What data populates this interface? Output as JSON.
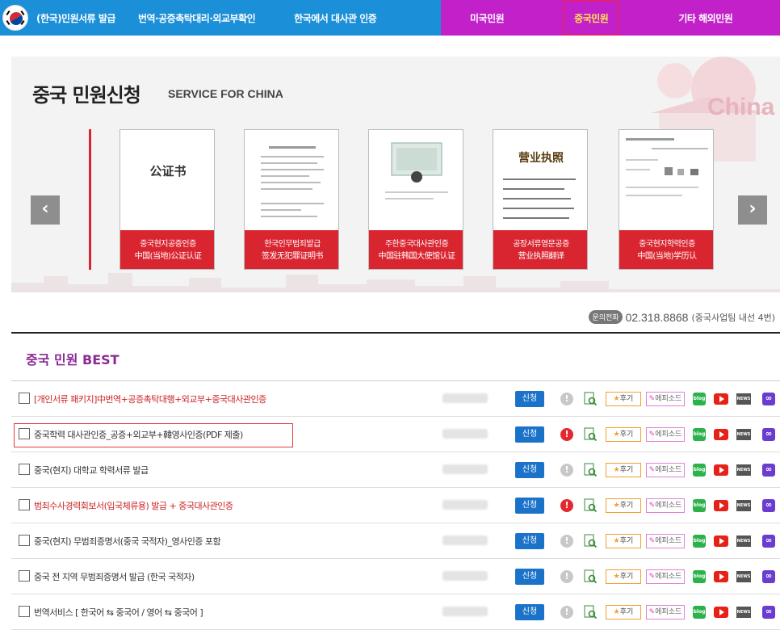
{
  "nav": {
    "items": [
      {
        "label": "(한국)민원서류 발급"
      },
      {
        "label": "번역·공증촉탁대리·외교부확인"
      },
      {
        "label": "한국에서 대사관 인증"
      },
      {
        "label": "미국민원"
      },
      {
        "label": "중국민원"
      },
      {
        "label": "기타 해외민원"
      }
    ]
  },
  "hero": {
    "title": "중국 민원신청",
    "subtitle": "SERVICE FOR CHINA",
    "deco_text": "China",
    "prev_label": "‹",
    "next_label": "›",
    "cards": [
      {
        "line1": "중국현지공증인증",
        "line2": "中国(当地)公证认证",
        "doc_text": "公证书"
      },
      {
        "line1": "한국인무범죄발급",
        "line2": "签发无犯罪证明书",
        "doc_text": ""
      },
      {
        "line1": "주한중국대사관인증",
        "line2": "中国驻韩国大使馆认证",
        "doc_text": ""
      },
      {
        "line1": "공장서류영문공증",
        "line2": "营业执照翻译",
        "doc_text": "营业执照"
      },
      {
        "line1": "중국현지학력인증",
        "line2": "中国(当地)学历认",
        "doc_text": ""
      }
    ]
  },
  "contact": {
    "badge": "문의전화",
    "phone": "02.318.8868",
    "note": "(중국사업팀 내선 4번)"
  },
  "best": {
    "title": "중국 민원 BEST",
    "apply_label": "신청",
    "review_label": "후기",
    "episode_label": "에피소드",
    "blog_label": "blog",
    "news_label": "NEWS",
    "rows": [
      {
        "title": "[개인서류 패키지]中번역+공증촉탁대행+외교부+중국대사관인증",
        "color": "red",
        "alert": false
      },
      {
        "title": "중국학력 대사관인증_공증+외교부+韓영사인증(PDF 제출)",
        "color": "dark",
        "alert": true
      },
      {
        "title": "중국(현지) 대학교 학력서류 발급",
        "color": "dark",
        "alert": false
      },
      {
        "title": "범죄수사경력회보서(입국체류용) 발급 + 중국대사관인증",
        "color": "red",
        "alert": true
      },
      {
        "title": "중국(현지) 무범죄증명서(중국 국적자)_영사인증 포함",
        "color": "dark",
        "alert": false
      },
      {
        "title": "중국 전 지역 무범죄증명서 발급 (한국 국적자)",
        "color": "dark",
        "alert": false
      },
      {
        "title": "번역서비스 [ 한국어 ⇆ 중국어 / 영어 ⇆ 중국어 ]",
        "color": "dark",
        "alert": false
      }
    ]
  }
}
